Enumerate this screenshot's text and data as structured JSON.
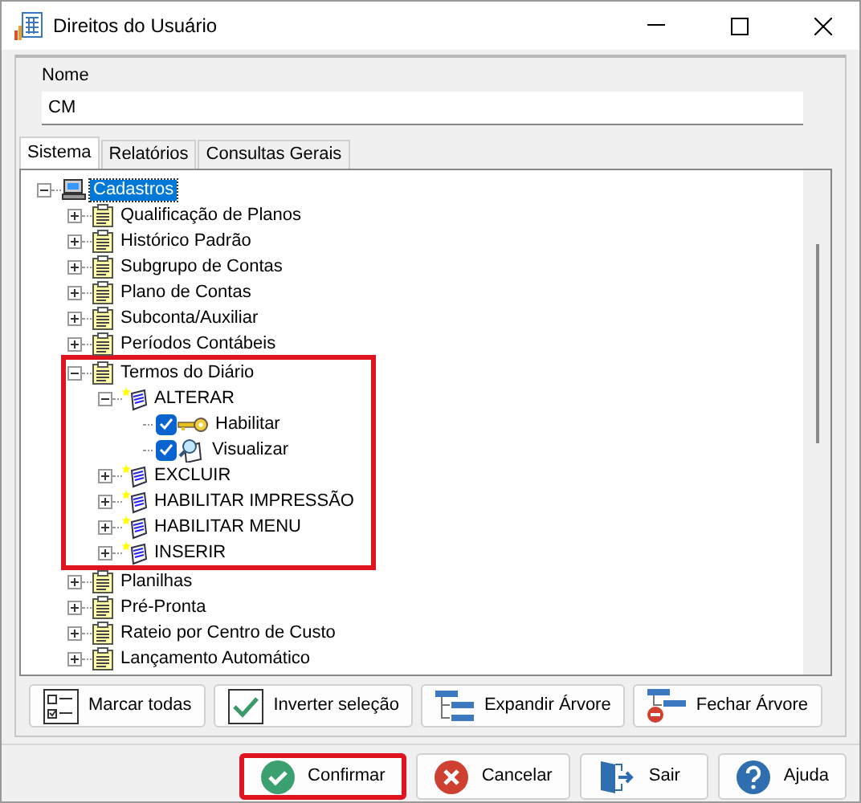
{
  "window": {
    "title": "Direitos do Usuário"
  },
  "name_field": {
    "label": "Nome",
    "value": "CM"
  },
  "tabs": [
    {
      "label": "Sistema",
      "selected": true
    },
    {
      "label": "Relatórios",
      "selected": false
    },
    {
      "label": "Consultas Gerais",
      "selected": false
    }
  ],
  "tree": [
    {
      "label": "Cadastros",
      "kind": "computer",
      "expanded": true,
      "selected": true,
      "children": [
        {
          "label": "Qualificação de Planos",
          "kind": "folder",
          "expanded": false,
          "selected": false
        },
        {
          "label": "Histórico Padrão",
          "kind": "folder",
          "expanded": false,
          "selected": false
        },
        {
          "label": "Subgrupo de Contas",
          "kind": "folder",
          "expanded": false,
          "selected": false
        },
        {
          "label": "Plano de Contas",
          "kind": "folder",
          "expanded": false,
          "selected": false
        },
        {
          "label": "Subconta/Auxiliar",
          "kind": "folder",
          "expanded": false,
          "selected": false
        },
        {
          "label": "Períodos Contábeis",
          "kind": "folder",
          "expanded": false,
          "selected": false
        },
        {
          "label": "Termos do Diário",
          "kind": "folder",
          "expanded": true,
          "selected": false,
          "highlighted": true,
          "children": [
            {
              "label": "ALTERAR",
              "kind": "action",
              "expanded": true,
              "selected": false,
              "children": [
                {
                  "label": "Habilitar",
                  "kind": "key",
                  "checked": true,
                  "selected": false
                },
                {
                  "label": "Visualizar",
                  "kind": "view",
                  "checked": true,
                  "selected": false
                }
              ]
            },
            {
              "label": "EXCLUIR",
              "kind": "action",
              "expanded": false,
              "selected": false
            },
            {
              "label": "HABILITAR IMPRESSÃO",
              "kind": "action",
              "expanded": false,
              "selected": false
            },
            {
              "label": "HABILITAR MENU",
              "kind": "action",
              "expanded": false,
              "selected": false
            },
            {
              "label": "INSERIR",
              "kind": "action",
              "expanded": false,
              "selected": false
            }
          ]
        },
        {
          "label": "Planilhas",
          "kind": "folder",
          "expanded": false,
          "selected": false
        },
        {
          "label": "Pré-Pronta",
          "kind": "folder",
          "expanded": false,
          "selected": false
        },
        {
          "label": "Rateio por Centro de Custo",
          "kind": "folder",
          "expanded": false,
          "selected": false
        },
        {
          "label": "Lançamento Automático",
          "kind": "folder",
          "expanded": false,
          "selected": false
        }
      ]
    }
  ],
  "tree_buttons": [
    {
      "label": "Marcar todas",
      "kind": "check-all"
    },
    {
      "label": "Inverter seleção",
      "kind": "invert"
    },
    {
      "label": "Expandir Árvore",
      "kind": "expand"
    },
    {
      "label": "Fechar Árvore",
      "kind": "collapse"
    }
  ],
  "dialog_buttons": [
    {
      "label": "Confirmar",
      "kind": "confirm",
      "highlighted": true
    },
    {
      "label": "Cancelar",
      "kind": "cancel",
      "highlighted": false
    },
    {
      "label": "Sair",
      "kind": "exit",
      "highlighted": false
    },
    {
      "label": "Ajuda",
      "kind": "help",
      "highlighted": false
    }
  ]
}
